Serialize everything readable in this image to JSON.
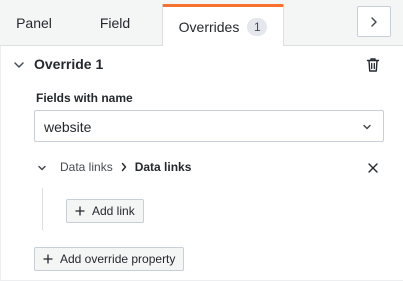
{
  "tabs": [
    {
      "label": "Panel"
    },
    {
      "label": "Field"
    },
    {
      "label": "Overrides",
      "count": "1",
      "active": true
    }
  ],
  "nav": {
    "icon": "chevron-right-icon"
  },
  "override": {
    "title": "Override 1",
    "collapse_icon": "chevron-down-icon",
    "delete_icon": "trash-icon",
    "matcher": {
      "label": "Fields with name",
      "value": "website",
      "dropdown_icon": "chevron-down-icon"
    },
    "property": {
      "category": "Data links",
      "name": "Data links",
      "separator_icon": "chevron-right-icon",
      "remove_icon": "close-icon",
      "add_link_label": "Add link"
    },
    "add_property_label": "Add override property"
  },
  "colors": {
    "active_tab_accent": "#f6722e",
    "tab_bar_bg": "#f4f5f5",
    "border": "#c7d0d9",
    "text": "#24292e"
  }
}
